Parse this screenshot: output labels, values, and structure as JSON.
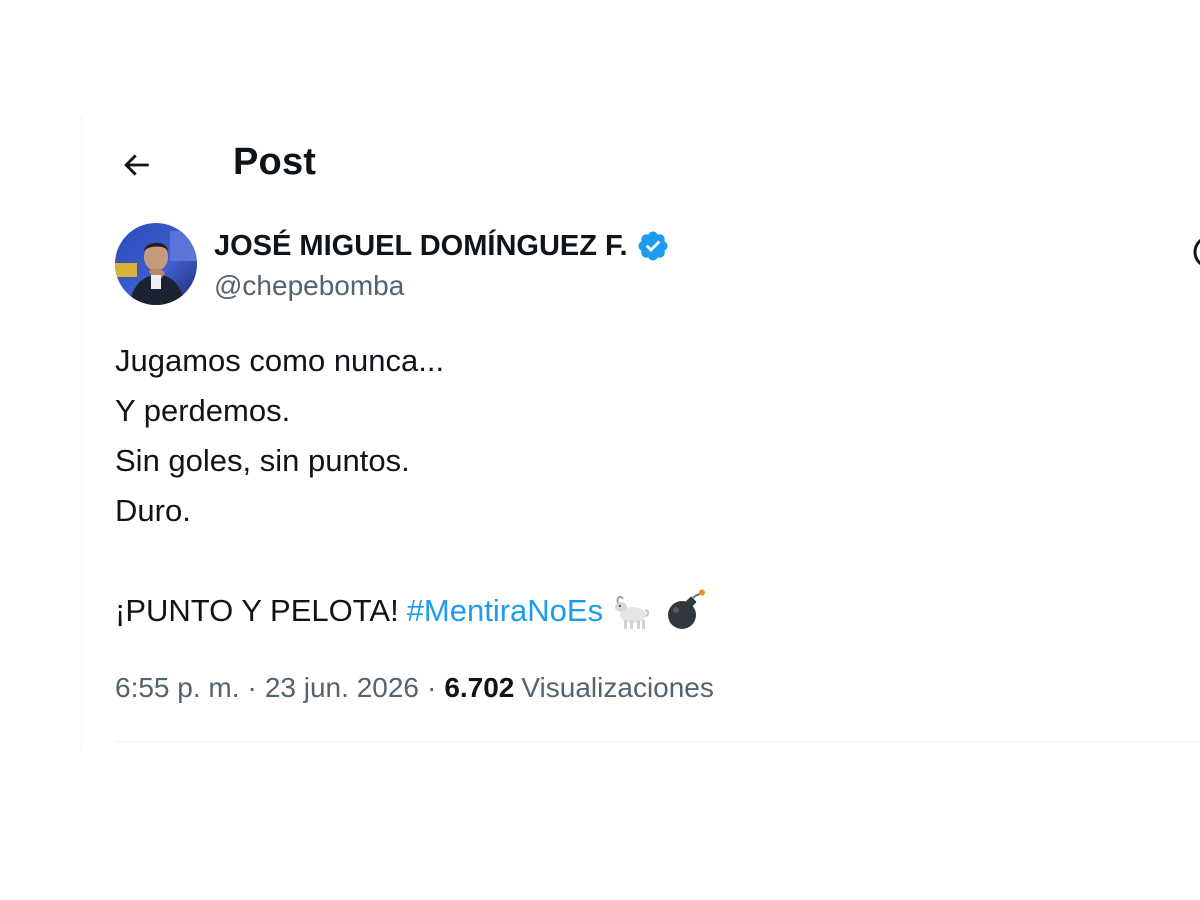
{
  "header": {
    "title": "Post",
    "back_icon": "arrow-left-icon"
  },
  "author": {
    "name": "JOSÉ MIGUEL DOMÍNGUEZ F.",
    "handle": "@chepebomba",
    "verified_icon": "verified-badge-icon",
    "verified_color": "#1d9bf0"
  },
  "tweet": {
    "lines": [
      "Jugamos como nunca...",
      "Y perdemos.",
      "Sin goles, sin puntos.",
      "Duro."
    ],
    "final_text": "¡PUNTO Y PELOTA!",
    "hashtag": "#MentiraNoEs",
    "emojis": [
      "goat-emoji",
      "bomb-emoji"
    ]
  },
  "meta": {
    "time": "6:55 p. m.",
    "separator": "·",
    "date": "23 jun. 2026",
    "views_count": "6.702",
    "views_label": "Visualizaciones"
  },
  "colors": {
    "text": "#0f1419",
    "secondary": "#536471",
    "link": "#1d9bf0",
    "border": "#eff3f4"
  }
}
